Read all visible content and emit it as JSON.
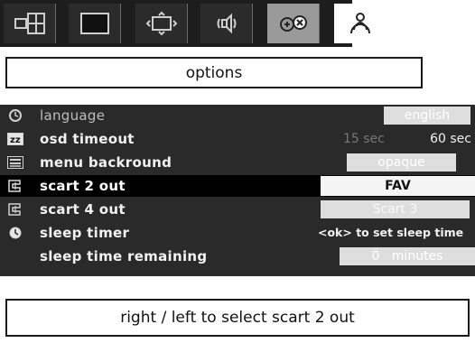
{
  "tabs": [
    {
      "icon": "layout-grid-icon",
      "active": false
    },
    {
      "icon": "screen-icon",
      "active": false
    },
    {
      "icon": "picture-frame-icon",
      "active": false
    },
    {
      "icon": "sound-icon",
      "active": false
    },
    {
      "icon": "options-icon",
      "active": true
    },
    {
      "icon": "channels-icon",
      "active": false
    }
  ],
  "title": "options",
  "menu": {
    "items": [
      {
        "label": "language",
        "value": "english",
        "icon": "clock-icon"
      },
      {
        "label": "osd timeout",
        "value": "60 sec",
        "value_faint": "15 sec",
        "icon": "zz-icon"
      },
      {
        "label": "menu backround",
        "value": "opaque",
        "icon": "menu-icon"
      },
      {
        "label": "scart 2 out",
        "value": "FAV",
        "icon": "scart-icon",
        "selected": true
      },
      {
        "label": "scart 4 out",
        "value": "Scart 3",
        "icon": "scart-icon"
      },
      {
        "label": "sleep timer",
        "value": "<ok> to set sleep time",
        "icon": "timer-icon"
      },
      {
        "label": "sleep time remaining",
        "value": "0   minutes"
      }
    ]
  },
  "footer": {
    "hint": "right / left to select scart 2 out"
  },
  "colors": {
    "background": "#2a2a2a",
    "highlight": "#000000",
    "panel_text": "#f2f2f2"
  }
}
